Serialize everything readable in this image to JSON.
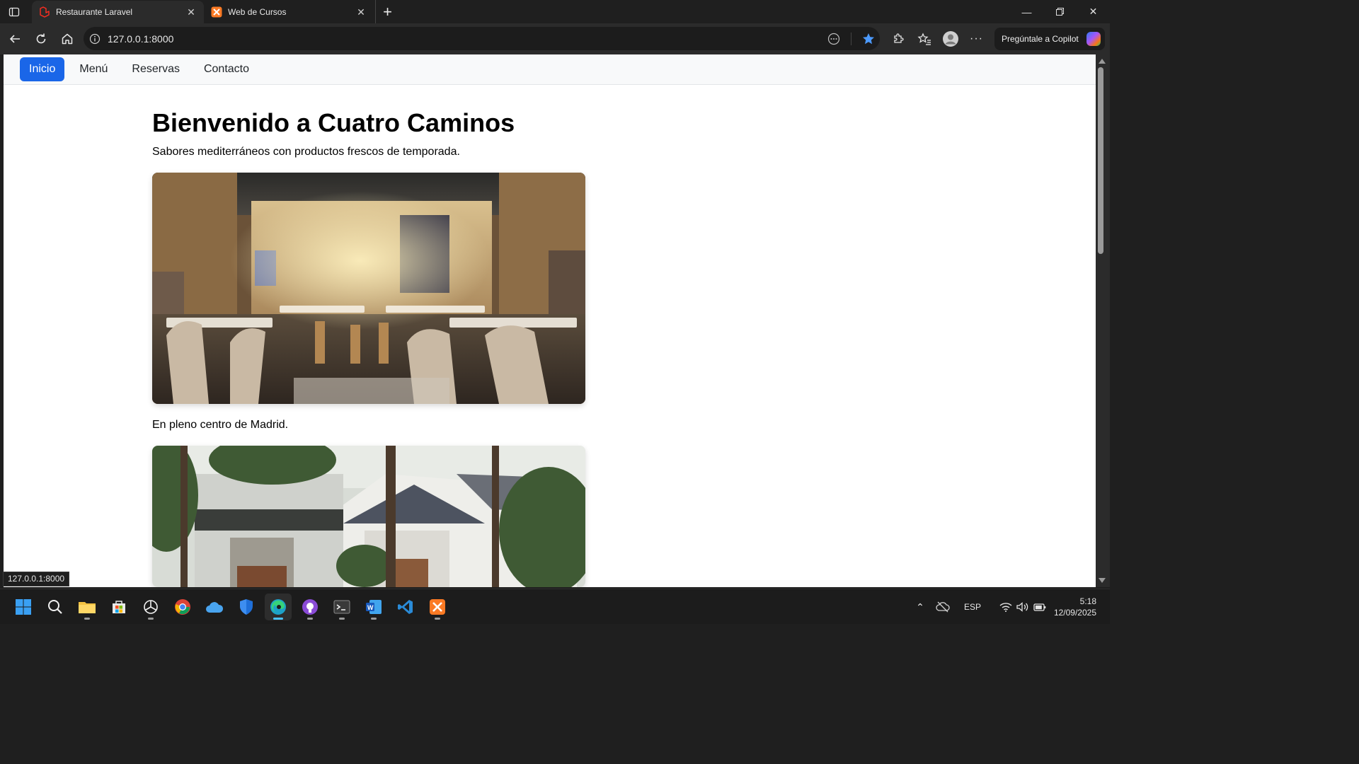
{
  "browser": {
    "tabs": [
      {
        "title": "Restaurante Laravel",
        "active": true,
        "favicon": "laravel-icon"
      },
      {
        "title": "Web de Cursos",
        "active": false,
        "favicon": "xampp-icon"
      }
    ],
    "url": "127.0.0.1:8000",
    "copilot_label": "Pregúntale a Copilot",
    "status_url": "127.0.0.1:8000"
  },
  "page": {
    "nav": [
      "Inicio",
      "Menú",
      "Reservas",
      "Contacto"
    ],
    "active_nav": "Inicio",
    "title": "Bienvenido a Cuatro Caminos",
    "lead": "Sabores mediterráneos con productos frescos de temporada.",
    "caption": "En pleno centro de Madrid."
  },
  "taskbar": {
    "apps": [
      "start-icon",
      "search-icon",
      "file-explorer-icon",
      "microsoft-store-icon",
      "chatgpt-icon",
      "chrome-icon",
      "onedrive-icon",
      "defender-icon",
      "edge-icon",
      "github-desktop-icon",
      "terminal-icon",
      "word-icon",
      "vscode-icon",
      "xampp-icon"
    ],
    "language": "ESP",
    "time": "5:18",
    "date": "12/09/2025"
  },
  "colors": {
    "accent": "#1a66e8",
    "browser_dark": "#1f1f1f"
  }
}
